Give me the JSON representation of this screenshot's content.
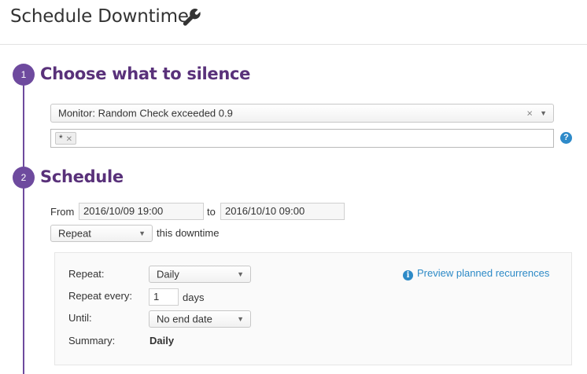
{
  "header": {
    "title": "Schedule Downtime",
    "icon": "wrench-icon"
  },
  "steps": [
    {
      "number": "1",
      "title": "Choose what to silence"
    },
    {
      "number": "2",
      "title": "Schedule"
    }
  ],
  "silence": {
    "monitor_select": "Monitor: Random Check exceeded 0.9",
    "scope_tags": [
      "*"
    ]
  },
  "schedule": {
    "from_label": "From",
    "from_value": "2016/10/09 19:00",
    "to_label": "to",
    "to_value": "2016/10/10 09:00",
    "mode_select": "Repeat",
    "mode_suffix": "this downtime",
    "recurrence": {
      "repeat_label": "Repeat:",
      "repeat_value": "Daily",
      "every_label": "Repeat every:",
      "every_value": "1",
      "every_unit": "days",
      "until_label": "Until:",
      "until_value": "No end date",
      "summary_label": "Summary:",
      "summary_value": "Daily",
      "preview_link": "Preview planned recurrences"
    }
  },
  "colors": {
    "accent": "#6e4a9e",
    "step_title": "#59317a",
    "link": "#2d8ac7"
  }
}
